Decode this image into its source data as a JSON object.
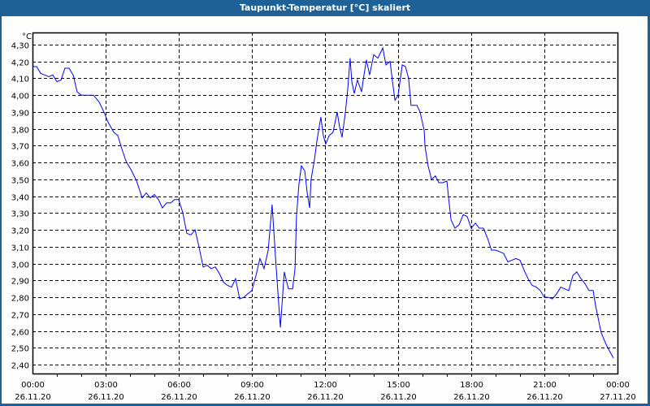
{
  "window": {
    "title": "Taupunkt-Temperatur [°C] skaliert"
  },
  "chart_data": {
    "type": "line",
    "title": "Taupunkt-Temperatur [°C] skaliert",
    "ylabel": "°C",
    "xlabel": "",
    "ylim": [
      2.33,
      4.37
    ],
    "xlim_hours": [
      0,
      24
    ],
    "yticks": [
      "4,30",
      "4,20",
      "4,10",
      "4,00",
      "3,90",
      "3,80",
      "3,70",
      "3,60",
      "3,50",
      "3,40",
      "3,30",
      "3,20",
      "3,10",
      "3,00",
      "2,90",
      "2,80",
      "2,70",
      "2,60",
      "2,50",
      "2,40"
    ],
    "ytick_values": [
      4.3,
      4.2,
      4.1,
      4.0,
      3.9,
      3.8,
      3.7,
      3.6,
      3.5,
      3.4,
      3.3,
      3.2,
      3.1,
      3.0,
      2.9,
      2.8,
      2.7,
      2.6,
      2.5,
      2.4
    ],
    "xticks": [
      {
        "hour": 0,
        "time": "00:00",
        "date": "26.11.20"
      },
      {
        "hour": 3,
        "time": "03:00",
        "date": "26.11.20"
      },
      {
        "hour": 6,
        "time": "06:00",
        "date": "26.11.20"
      },
      {
        "hour": 9,
        "time": "09:00",
        "date": "26.11.20"
      },
      {
        "hour": 12,
        "time": "12:00",
        "date": "26.11.20"
      },
      {
        "hour": 15,
        "time": "15:00",
        "date": "26.11.20"
      },
      {
        "hour": 18,
        "time": "18:00",
        "date": "26.11.20"
      },
      {
        "hour": 21,
        "time": "21:00",
        "date": "26.11.20"
      },
      {
        "hour": 24,
        "time": "00:00",
        "date": "27.11.20"
      }
    ],
    "grid": true,
    "series": [
      {
        "name": "Taupunkt",
        "color": "#0000ff",
        "points": [
          [
            0,
            4.17
          ],
          [
            0.17,
            4.17
          ],
          [
            0.33,
            4.13
          ],
          [
            0.5,
            4.12
          ],
          [
            0.67,
            4.11
          ],
          [
            0.83,
            4.12
          ],
          [
            1,
            4.08
          ],
          [
            1.17,
            4.09
          ],
          [
            1.33,
            4.16
          ],
          [
            1.5,
            4.16
          ],
          [
            1.67,
            4.12
          ],
          [
            1.83,
            4.02
          ],
          [
            2,
            4.0
          ],
          [
            2.27,
            4.0
          ],
          [
            2.5,
            4.0
          ],
          [
            2.73,
            3.96
          ],
          [
            2.93,
            3.9
          ],
          [
            3.1,
            3.84
          ],
          [
            3.33,
            3.78
          ],
          [
            3.5,
            3.76
          ],
          [
            3.67,
            3.68
          ],
          [
            3.83,
            3.61
          ],
          [
            4.07,
            3.55
          ],
          [
            4.27,
            3.49
          ],
          [
            4.5,
            3.39
          ],
          [
            4.67,
            3.42
          ],
          [
            4.83,
            3.39
          ],
          [
            5,
            3.41
          ],
          [
            5.17,
            3.38
          ],
          [
            5.33,
            3.33
          ],
          [
            5.5,
            3.36
          ],
          [
            5.67,
            3.36
          ],
          [
            5.83,
            3.38
          ],
          [
            6,
            3.38
          ],
          [
            6.17,
            3.3
          ],
          [
            6.33,
            3.18
          ],
          [
            6.5,
            3.17
          ],
          [
            6.67,
            3.2
          ],
          [
            6.83,
            3.1
          ],
          [
            7,
            2.98
          ],
          [
            7.17,
            2.99
          ],
          [
            7.33,
            2.97
          ],
          [
            7.5,
            2.98
          ],
          [
            7.67,
            2.94
          ],
          [
            7.83,
            2.89
          ],
          [
            8,
            2.87
          ],
          [
            8.17,
            2.86
          ],
          [
            8.33,
            2.91
          ],
          [
            8.5,
            2.79
          ],
          [
            8.67,
            2.8
          ],
          [
            8.83,
            2.82
          ],
          [
            9,
            2.84
          ],
          [
            9.17,
            2.93
          ],
          [
            9.33,
            3.03
          ],
          [
            9.5,
            2.97
          ],
          [
            9.67,
            3.08
          ],
          [
            9.83,
            3.35
          ],
          [
            10,
            2.97
          ],
          [
            10.17,
            2.62
          ],
          [
            10.33,
            2.95
          ],
          [
            10.5,
            2.85
          ],
          [
            10.67,
            2.85
          ],
          [
            10.77,
            2.97
          ],
          [
            10.83,
            3.28
          ],
          [
            10.93,
            3.47
          ],
          [
            11.03,
            3.58
          ],
          [
            11.17,
            3.55
          ],
          [
            11.27,
            3.42
          ],
          [
            11.37,
            3.33
          ],
          [
            11.43,
            3.5
          ],
          [
            11.57,
            3.62
          ],
          [
            11.67,
            3.73
          ],
          [
            11.83,
            3.87
          ],
          [
            11.93,
            3.76
          ],
          [
            12.03,
            3.71
          ],
          [
            12.17,
            3.76
          ],
          [
            12.33,
            3.78
          ],
          [
            12.5,
            3.9
          ],
          [
            12.6,
            3.81
          ],
          [
            12.7,
            3.75
          ],
          [
            12.83,
            3.89
          ],
          [
            12.93,
            4.03
          ],
          [
            13.03,
            4.22
          ],
          [
            13.1,
            4.08
          ],
          [
            13.2,
            4.01
          ],
          [
            13.33,
            4.09
          ],
          [
            13.5,
            4.02
          ],
          [
            13.6,
            4.12
          ],
          [
            13.7,
            4.21
          ],
          [
            13.83,
            4.12
          ],
          [
            14,
            4.24
          ],
          [
            14.17,
            4.22
          ],
          [
            14.37,
            4.28
          ],
          [
            14.5,
            4.18
          ],
          [
            14.67,
            4.2
          ],
          [
            14.77,
            4.08
          ],
          [
            14.87,
            3.97
          ],
          [
            15,
            4.0
          ],
          [
            15.17,
            4.18
          ],
          [
            15.3,
            4.17
          ],
          [
            15.43,
            4.1
          ],
          [
            15.53,
            3.94
          ],
          [
            15.77,
            3.94
          ],
          [
            15.9,
            3.9
          ],
          [
            16.07,
            3.79
          ],
          [
            16.1,
            3.7
          ],
          [
            16.23,
            3.58
          ],
          [
            16.37,
            3.5
          ],
          [
            16.53,
            3.52
          ],
          [
            16.67,
            3.48
          ],
          [
            16.83,
            3.48
          ],
          [
            17,
            3.49
          ],
          [
            17.07,
            3.39
          ],
          [
            17.17,
            3.26
          ],
          [
            17.33,
            3.21
          ],
          [
            17.5,
            3.23
          ],
          [
            17.67,
            3.29
          ],
          [
            17.83,
            3.28
          ],
          [
            18,
            3.21
          ],
          [
            18.17,
            3.24
          ],
          [
            18.33,
            3.21
          ],
          [
            18.5,
            3.21
          ],
          [
            18.67,
            3.15
          ],
          [
            18.83,
            3.08
          ],
          [
            19,
            3.08
          ],
          [
            19.17,
            3.07
          ],
          [
            19.33,
            3.06
          ],
          [
            19.5,
            3.01
          ],
          [
            19.67,
            3.02
          ],
          [
            19.83,
            3.03
          ],
          [
            20,
            3.02
          ],
          [
            20.17,
            2.96
          ],
          [
            20.33,
            2.91
          ],
          [
            20.5,
            2.87
          ],
          [
            20.67,
            2.86
          ],
          [
            20.83,
            2.84
          ],
          [
            21,
            2.8
          ],
          [
            21.17,
            2.8
          ],
          [
            21.33,
            2.79
          ],
          [
            21.5,
            2.82
          ],
          [
            21.67,
            2.86
          ],
          [
            21.83,
            2.85
          ],
          [
            22,
            2.84
          ],
          [
            22.17,
            2.93
          ],
          [
            22.33,
            2.95
          ],
          [
            22.5,
            2.91
          ],
          [
            22.67,
            2.88
          ],
          [
            22.83,
            2.84
          ],
          [
            23,
            2.84
          ],
          [
            23.1,
            2.75
          ],
          [
            23.33,
            2.59
          ],
          [
            23.5,
            2.53
          ],
          [
            23.6,
            2.5
          ],
          [
            23.83,
            2.44
          ]
        ]
      }
    ]
  }
}
